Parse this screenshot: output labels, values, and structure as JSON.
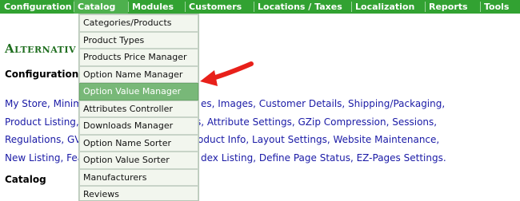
{
  "nav": {
    "items": [
      "Configuration",
      "Catalog",
      "Modules",
      "Customers",
      "Locations / Taxes",
      "Localization",
      "Reports",
      "Tools"
    ]
  },
  "page": {
    "heading": "Alternativ",
    "config_title": "Configuration",
    "config_links_line1": "My Store, Minim",
    "config_links_line1b": "es, Images, Customer Details, Shipping/Packaging,",
    "config_links_line2": "Product Listing,",
    "config_links_line2b": "ons, Attribute Settings, GZip Compression, Sessions,",
    "config_links_line3": "Regulations, GV",
    "config_links_line3b": "oduct Info, Layout Settings, Website Maintenance,",
    "config_links_line4": "New Listing, Fea",
    "config_links_line4b": "dex Listing, Define Page Status, EZ-Pages Settings.",
    "catalog_title": "Catalog"
  },
  "dropdown": {
    "items": [
      "Categories/Products",
      "Product Types",
      "Products Price Manager",
      "Option Name Manager",
      "Option Value Manager",
      "Attributes Controller",
      "Downloads Manager",
      "Option Name Sorter",
      "Option Value Sorter",
      "Manufacturers",
      "Reviews"
    ]
  },
  "colors": {
    "nav_bg": "#32a232",
    "active_item": "#78b878",
    "arrow": "#e8201a",
    "link": "#1a1aa6"
  },
  "arrow": {
    "icon": "red-pointer-arrow"
  }
}
